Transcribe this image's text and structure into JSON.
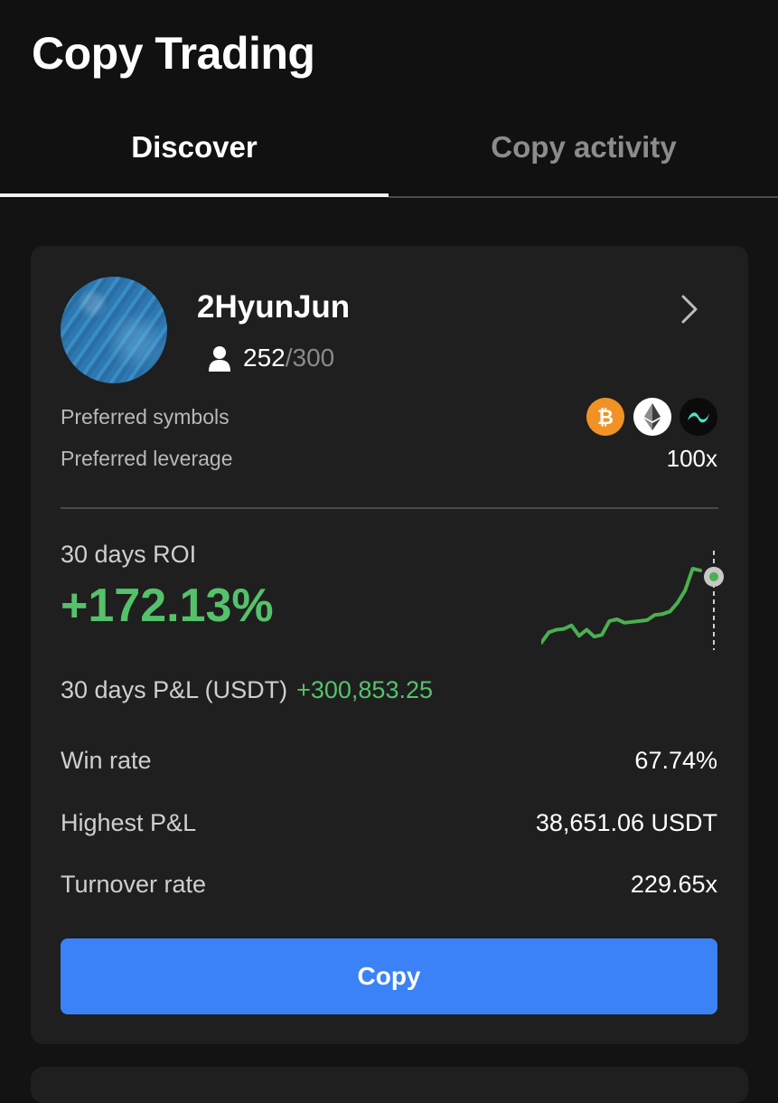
{
  "page": {
    "title": "Copy Trading"
  },
  "tabs": [
    {
      "label": "Discover",
      "active": true
    },
    {
      "label": "Copy activity",
      "active": false
    }
  ],
  "trader": {
    "name": "2HyunJun",
    "followers": {
      "current": "252",
      "separator": "/",
      "max": "300"
    },
    "preferred_symbols_label": "Preferred symbols",
    "symbols": [
      {
        "icon": "bitcoin-icon",
        "color": "#f09226"
      },
      {
        "icon": "ethereum-icon",
        "color": "#ffffff"
      },
      {
        "icon": "token-icon",
        "color": "#4fe0c8"
      }
    ],
    "preferred_leverage_label": "Preferred leverage",
    "preferred_leverage_value": "100x"
  },
  "roi": {
    "label": "30 days ROI",
    "value": "+172.13%",
    "sparkline": [
      0,
      12,
      15,
      16,
      20,
      8,
      15,
      7,
      9,
      25,
      27,
      23,
      24,
      25,
      26,
      32,
      33,
      36,
      46,
      60,
      85,
      83
    ]
  },
  "pnl": {
    "label": "30 days P&L (USDT)",
    "value": "+300,853.25"
  },
  "stats": [
    {
      "label": "Win rate",
      "value": "67.74%"
    },
    {
      "label": "Highest P&L",
      "value": "38,651.06 USDT"
    },
    {
      "label": "Turnover rate",
      "value": "229.65x"
    }
  ],
  "copy_button_label": "Copy",
  "colors": {
    "accent": "#3b82f6",
    "positive": "#55c26b",
    "card": "#1f1f1f",
    "background": "#131313"
  }
}
